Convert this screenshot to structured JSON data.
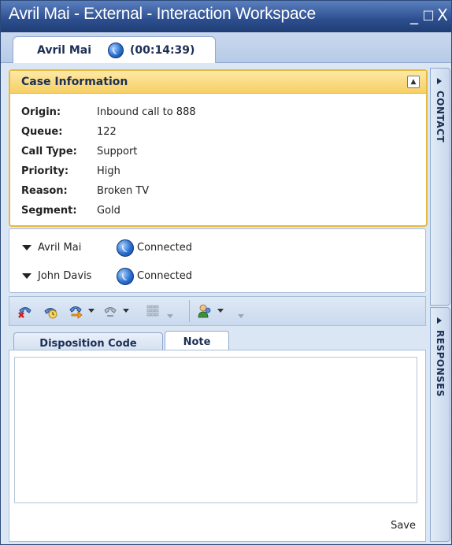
{
  "window": {
    "title": "Avril Mai - External - Interaction Workspace",
    "minimize_glyph": "_",
    "maximize_glyph": "□",
    "close_glyph": "X"
  },
  "top_tab": {
    "name": "Avril Mai",
    "timer": "(00:14:39)",
    "icon": "globe-icon"
  },
  "case": {
    "title": "Case Information",
    "collapse_glyph": "▲",
    "fields": [
      {
        "label": "Origin:",
        "value": "Inbound call to 888"
      },
      {
        "label": "Queue:",
        "value": "122"
      },
      {
        "label": "Call Type:",
        "value": "Support"
      },
      {
        "label": "Priority:",
        "value": "High"
      },
      {
        "label": "Reason:",
        "value": "Broken TV"
      },
      {
        "label": "Segment:",
        "value": "Gold"
      }
    ]
  },
  "parties": [
    {
      "name": "Avril Mai",
      "status": "Connected"
    },
    {
      "name": "John Davis",
      "status": "Connected"
    }
  ],
  "toolbar": {
    "buttons": [
      "hangup-icon",
      "hold-icon",
      "transfer-icon",
      "conference-icon",
      "keypad-icon",
      "consult-icon"
    ]
  },
  "tabs": {
    "disposition": "Disposition Code",
    "note": "Note"
  },
  "note": {
    "save_label": "Save"
  },
  "side": {
    "contact": "CONTACT",
    "responses": "RESPONSES"
  },
  "colors": {
    "title_bar": "#2d4f8f",
    "case_border": "#e9b93c",
    "case_header": "#f7cf64",
    "panel_bg": "#dbe6f5"
  }
}
